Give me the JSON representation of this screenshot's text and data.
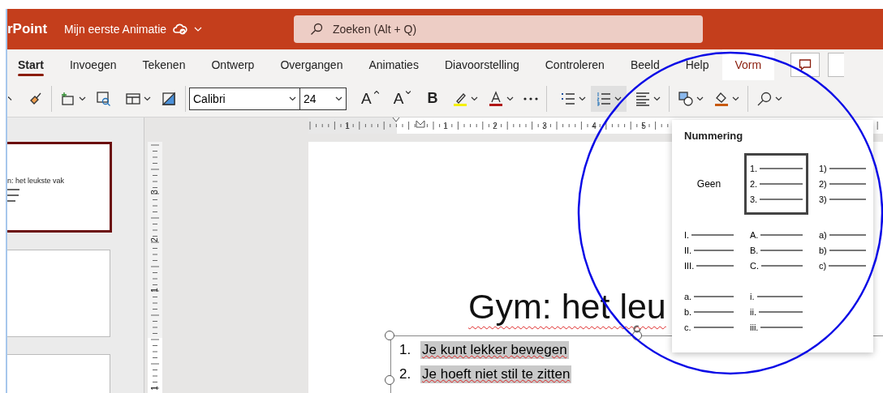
{
  "title_bar": {
    "app_name": "rPoint",
    "document_title": "Mijn eerste Animatie",
    "search": {
      "placeholder": "Zoeken (Alt + Q)"
    }
  },
  "tabs": [
    {
      "label": "Start",
      "selected": true,
      "kind": "standard"
    },
    {
      "label": "Invoegen",
      "selected": false,
      "kind": "standard"
    },
    {
      "label": "Tekenen",
      "selected": false,
      "kind": "standard"
    },
    {
      "label": "Ontwerp",
      "selected": false,
      "kind": "standard"
    },
    {
      "label": "Overgangen",
      "selected": false,
      "kind": "standard"
    },
    {
      "label": "Animaties",
      "selected": false,
      "kind": "standard"
    },
    {
      "label": "Diavoorstelling",
      "selected": false,
      "kind": "standard"
    },
    {
      "label": "Controleren",
      "selected": false,
      "kind": "standard"
    },
    {
      "label": "Beeld",
      "selected": false,
      "kind": "standard"
    },
    {
      "label": "Help",
      "selected": false,
      "kind": "standard"
    },
    {
      "label": "Vorm",
      "selected": false,
      "kind": "contextual"
    }
  ],
  "toolbar": {
    "font": "Calibri",
    "size": "24",
    "grow_label": "A",
    "shrink_label": "A",
    "bold_label": "B",
    "numbering_button": {
      "selected": true
    }
  },
  "rulers": {
    "horizontal": [
      "1",
      "1",
      "2",
      "3",
      "4",
      "5"
    ],
    "vertical": [
      "3",
      "2",
      "1",
      "1"
    ]
  },
  "slide_panel": {
    "slides": [
      {
        "title": "n: het leukste vak",
        "selected": true
      },
      {
        "selected": false
      },
      {
        "selected": false
      }
    ]
  },
  "slide": {
    "title": "Gym: het leu",
    "items": [
      {
        "number": "1.",
        "text": "Je kunt lekker bewegen"
      },
      {
        "number": "2.",
        "text": "Je hoeft niet stil te zitten"
      }
    ]
  },
  "numbering_menu": {
    "title": "Nummering",
    "options": [
      {
        "kind": "none",
        "label": "Geen",
        "selected": false
      },
      {
        "kind": "list",
        "markers": [
          "1.",
          "2.",
          "3."
        ],
        "selected": true
      },
      {
        "kind": "list",
        "markers": [
          "1)",
          "2)",
          "3)"
        ],
        "selected": false
      },
      {
        "kind": "list",
        "markers": [
          "I.",
          "II.",
          "III."
        ],
        "selected": false
      },
      {
        "kind": "list",
        "markers": [
          "A.",
          "B.",
          "C."
        ],
        "selected": false
      },
      {
        "kind": "list",
        "markers": [
          "a)",
          "b)",
          "c)"
        ],
        "selected": false
      },
      {
        "kind": "list",
        "markers": [
          "a.",
          "b.",
          "c."
        ],
        "selected": false
      },
      {
        "kind": "list",
        "markers": [
          "i.",
          "ii.",
          "iii."
        ],
        "selected": false
      }
    ]
  }
}
